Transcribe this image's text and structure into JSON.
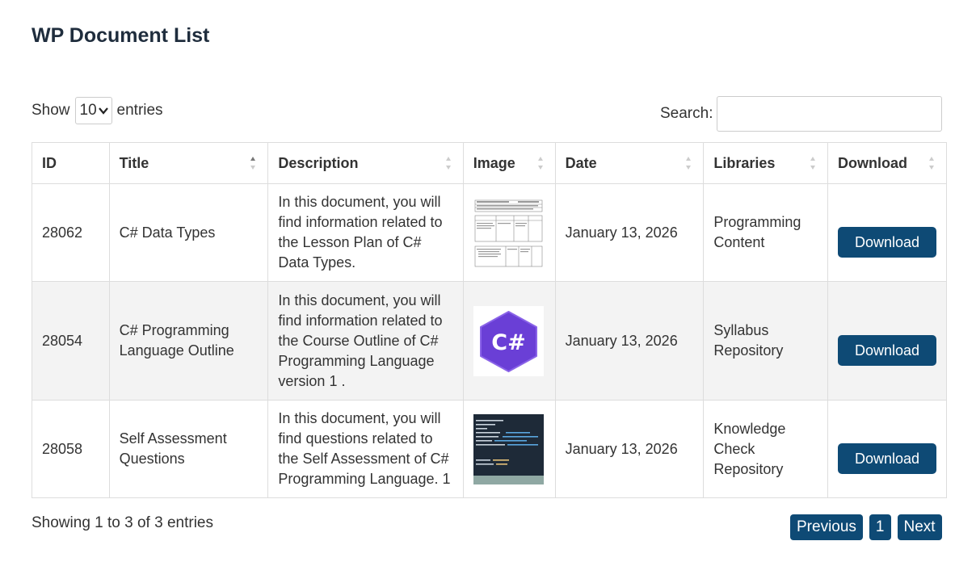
{
  "page": {
    "title": "WP Document List"
  },
  "controls": {
    "show_label": "Show",
    "page_length": "10",
    "entries_label": "entries",
    "search_label": "Search:",
    "search_value": ""
  },
  "table": {
    "headers": [
      "ID",
      "Title",
      "Description",
      "Image",
      "Date",
      "Libraries",
      "Download"
    ],
    "rows": [
      {
        "id": "28062",
        "title": "C# Data Types",
        "description": "In this document, you will find information related to the Lesson Plan of C# Data Types.",
        "image": "lesson-plan-document-thumbnail",
        "date": "January 13, 2026",
        "libraries": "Programming Content",
        "download_label": "Download"
      },
      {
        "id": "28054",
        "title": "C# Programming Language Outline",
        "description": "In this document, you will find information related to the Course Outline of C# Programming Language version 1 .",
        "image": "csharp-logo-thumbnail",
        "image_text": "C#",
        "date": "January 13, 2026",
        "libraries": "Syllabus Repository",
        "download_label": "Download"
      },
      {
        "id": "28058",
        "title": "Self Assessment Questions",
        "description": "In this document, you will find questions related to the Self Assessment of C# Programming Language. 1",
        "image": "code-editor-thumbnail",
        "date": "January 13, 2026",
        "libraries": "Knowledge Check Repository",
        "download_label": "Download"
      }
    ]
  },
  "footer": {
    "info": "Showing 1 to 3 of 3 entries",
    "previous_label": "Previous",
    "page_number": "1",
    "next_label": "Next"
  },
  "colors": {
    "primary_button": "#0e4a75",
    "title_text": "#1f2d3d",
    "striped_row": "#f3f3f3",
    "csharp_purple": "#6a3fd6"
  }
}
